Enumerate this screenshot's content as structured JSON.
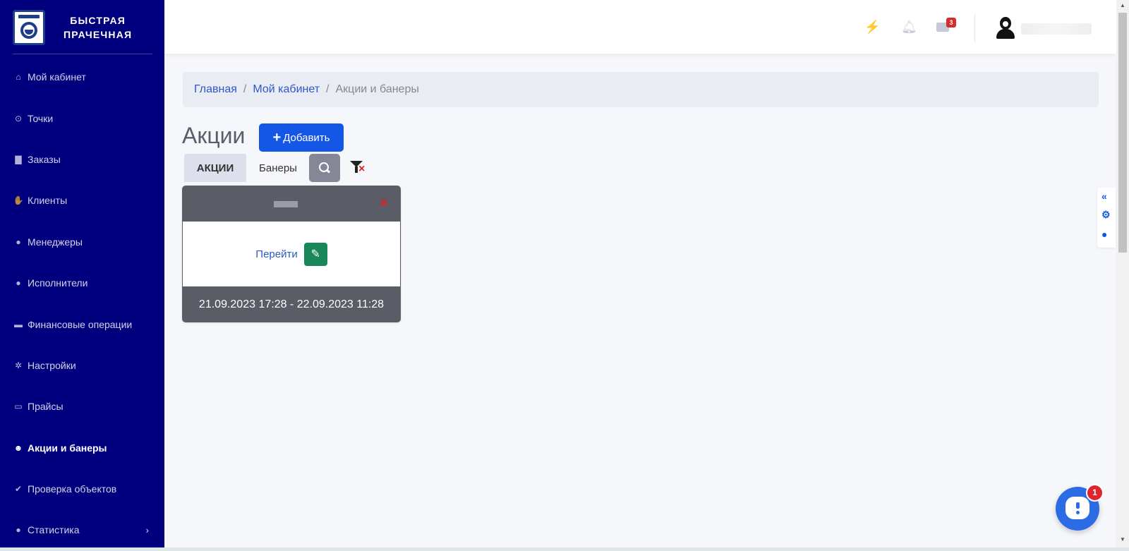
{
  "brand": {
    "line1": "БЫСТРАЯ",
    "line2": "ПРАЧЕЧНАЯ",
    "logo_icon": "washing-machine-icon"
  },
  "sidebar": {
    "items": [
      {
        "label": "Мой кабинет",
        "icon": "home-icon"
      },
      {
        "label": "Точки",
        "icon": "dot-circle-icon"
      },
      {
        "label": "Заказы",
        "icon": "shopping-bag-icon"
      },
      {
        "label": "Клиенты",
        "icon": "handshake-icon"
      },
      {
        "label": "Менеджеры",
        "icon": "users-icon"
      },
      {
        "label": "Исполнители",
        "icon": "users-icon"
      },
      {
        "label": "Финансовые операции",
        "icon": "money-bill-icon"
      },
      {
        "label": "Настройки",
        "icon": "gear-icon"
      },
      {
        "label": "Прайсы",
        "icon": "money-bill-icon"
      },
      {
        "label": "Акции и банеры",
        "icon": "smile-icon",
        "active": true
      },
      {
        "label": "Проверка объектов",
        "icon": "check-circle-icon"
      },
      {
        "label": "Статистика",
        "icon": "lightbulb-icon",
        "has_submenu": true
      }
    ]
  },
  "topbar": {
    "mail_badge": "3",
    "icons": [
      "bolt-icon",
      "bell-icon",
      "envelope-icon",
      "user-avatar-icon"
    ]
  },
  "breadcrumb": {
    "home": "Главная",
    "cabinet": "Мой кабинет",
    "current": "Акции и банеры",
    "separator": "/"
  },
  "page": {
    "title": "Акции",
    "add_button": "Добавить",
    "tabs": {
      "actions": "АКЦИИ",
      "banners": "Банеры"
    }
  },
  "card": {
    "link": "Перейти",
    "date_range": "21.09.2023 17:28 - 22.09.2023 11:28"
  },
  "chat": {
    "badge": "1"
  },
  "colors": {
    "sidebar": "#00007f",
    "primary": "#1457e6",
    "success": "#18885a",
    "danger": "#e02020",
    "card_header": "#5a5c66"
  }
}
